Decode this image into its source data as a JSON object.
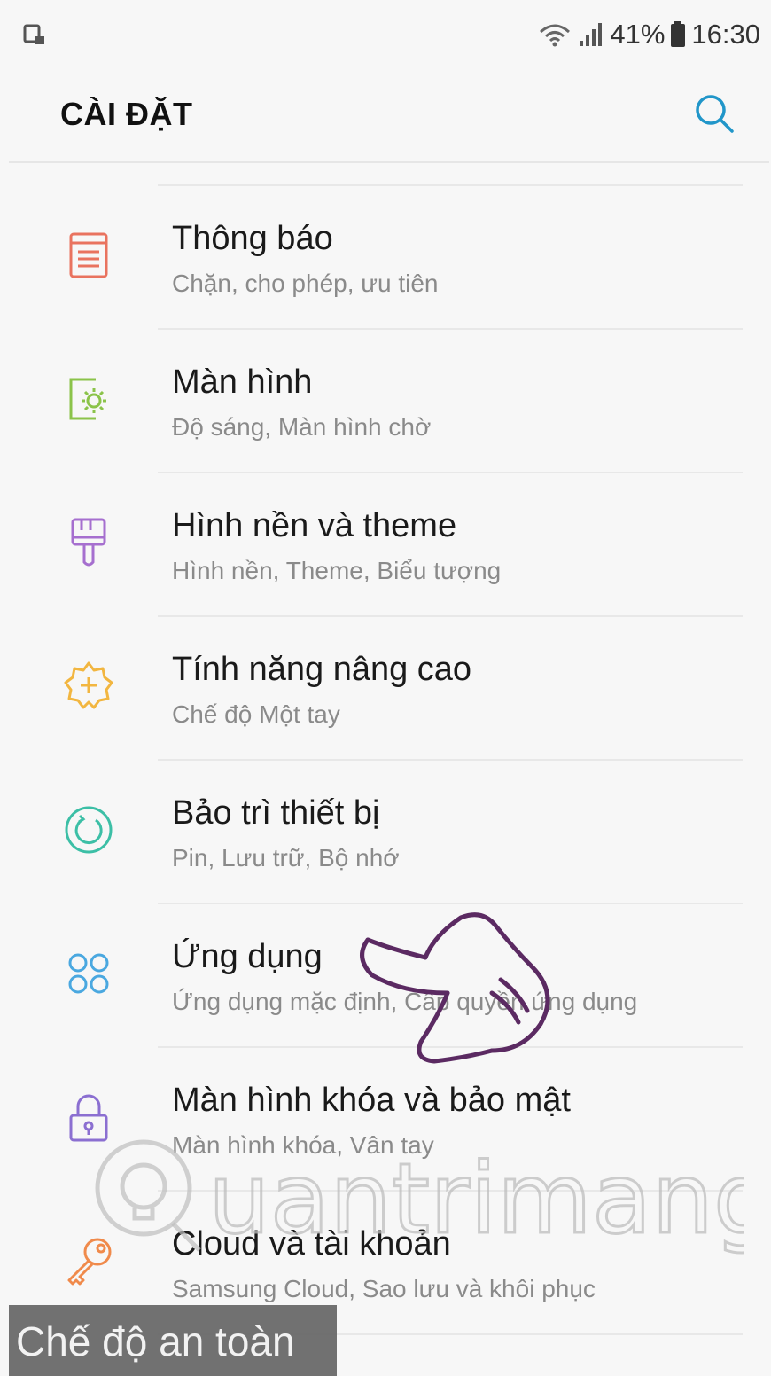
{
  "status": {
    "battery": "41%",
    "time": "16:30",
    "left_icon": "screenshot-icon",
    "right_icons": [
      "wifi-icon",
      "signal-icon",
      "battery-icon"
    ]
  },
  "app_bar": {
    "title": "CÀI ĐẶT",
    "search_icon": "search-icon"
  },
  "items": [
    {
      "title": "Thông báo",
      "subtitle": "Chặn, cho phép, ưu tiên",
      "icon": "notifications-icon",
      "color": "#e9735f"
    },
    {
      "title": "Màn hình",
      "subtitle": "Độ sáng, Màn hình chờ",
      "icon": "display-icon",
      "color": "#8bc34a"
    },
    {
      "title": "Hình nền và theme",
      "subtitle": "Hình nền, Theme, Biểu tượng",
      "icon": "wallpaper-brush-icon",
      "color": "#a66fcf"
    },
    {
      "title": "Tính năng nâng cao",
      "subtitle": "Chế độ Một tay",
      "icon": "advanced-features-icon",
      "color": "#f2b640"
    },
    {
      "title": "Bảo trì thiết bị",
      "subtitle": "Pin, Lưu trữ, Bộ nhớ",
      "icon": "device-maintenance-icon",
      "color": "#3cbfa6"
    },
    {
      "title": "Ứng dụng",
      "subtitle": "Ứng dụng mặc định, Cấp quyền ứng dụng",
      "icon": "apps-icon",
      "color": "#4aa8e0"
    },
    {
      "title": "Màn hình khóa và bảo mật",
      "subtitle": "Màn hình khóa, Vân tay",
      "icon": "lock-icon",
      "color": "#8b6fd1"
    },
    {
      "title": "Cloud và tài khoản",
      "subtitle": "Samsung Cloud, Sao lưu và khôi phục",
      "icon": "key-icon",
      "color": "#f08a4b"
    }
  ],
  "safe_mode_label": "Chế độ an toàn",
  "watermark_text": "Quantrimang"
}
